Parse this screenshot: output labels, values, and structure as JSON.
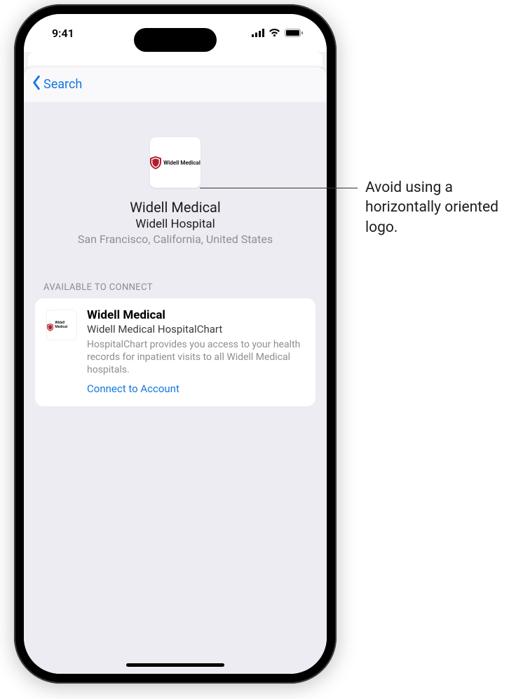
{
  "status": {
    "time": "9:41"
  },
  "nav": {
    "back_label": "Search"
  },
  "header": {
    "logo_text": "Widell Medical",
    "org_name": "Widell Medical",
    "org_subname": "Widell Hospital",
    "location": "San Francisco, California, United States"
  },
  "section": {
    "label": "AVAILABLE TO CONNECT"
  },
  "card": {
    "logo_text": "Widell Medical",
    "title": "Widell Medical",
    "subtitle": "Widell Medical HospitalChart",
    "description": "HospitalChart provides you access to your health records for inpatient visits to all Widell Medical hospitals.",
    "connect_label": "Connect to Account"
  },
  "callout": {
    "text": "Avoid using a horizontally oriented logo."
  }
}
